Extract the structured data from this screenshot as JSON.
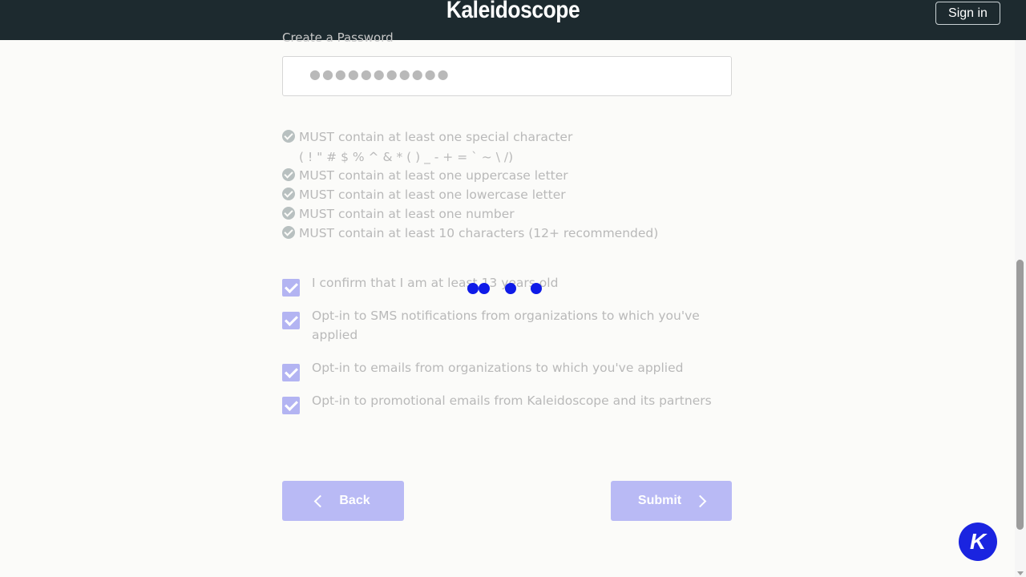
{
  "header": {
    "brand": "Kaleidoscope",
    "sign_in": "Sign in"
  },
  "password": {
    "label": "Create a Password",
    "masked_value": "●●●●●●●●●●●"
  },
  "rules": [
    {
      "text": "MUST contain at least one special character"
    },
    {
      "text": "MUST contain at least one uppercase letter"
    },
    {
      "text": "MUST contain at least one lowercase letter"
    },
    {
      "text": "MUST contain at least one number"
    },
    {
      "text": "MUST contain at least 10 characters (12+ recommended)"
    }
  ],
  "special_chars": "( ! \" # $ % ^ & * ( ) _ - + = ` ~ \\ /)",
  "checkboxes": [
    {
      "label": "I confirm that I am at least 13 years old",
      "checked": true
    },
    {
      "label": "Opt-in to SMS notifications from organizations to which you've applied",
      "checked": true
    },
    {
      "label": "Opt-in to emails from organizations to which you've applied",
      "checked": true
    },
    {
      "label": "Opt-in to promotional emails from Kaleidoscope and its partners",
      "checked": true
    }
  ],
  "buttons": {
    "back": "Back",
    "submit": "Submit"
  },
  "chat_bubble": {
    "letter": "K"
  },
  "colors": {
    "header_bg": "#1d2a2f",
    "accent": "#1a24e0",
    "button_disabled": "#b9baf5"
  }
}
